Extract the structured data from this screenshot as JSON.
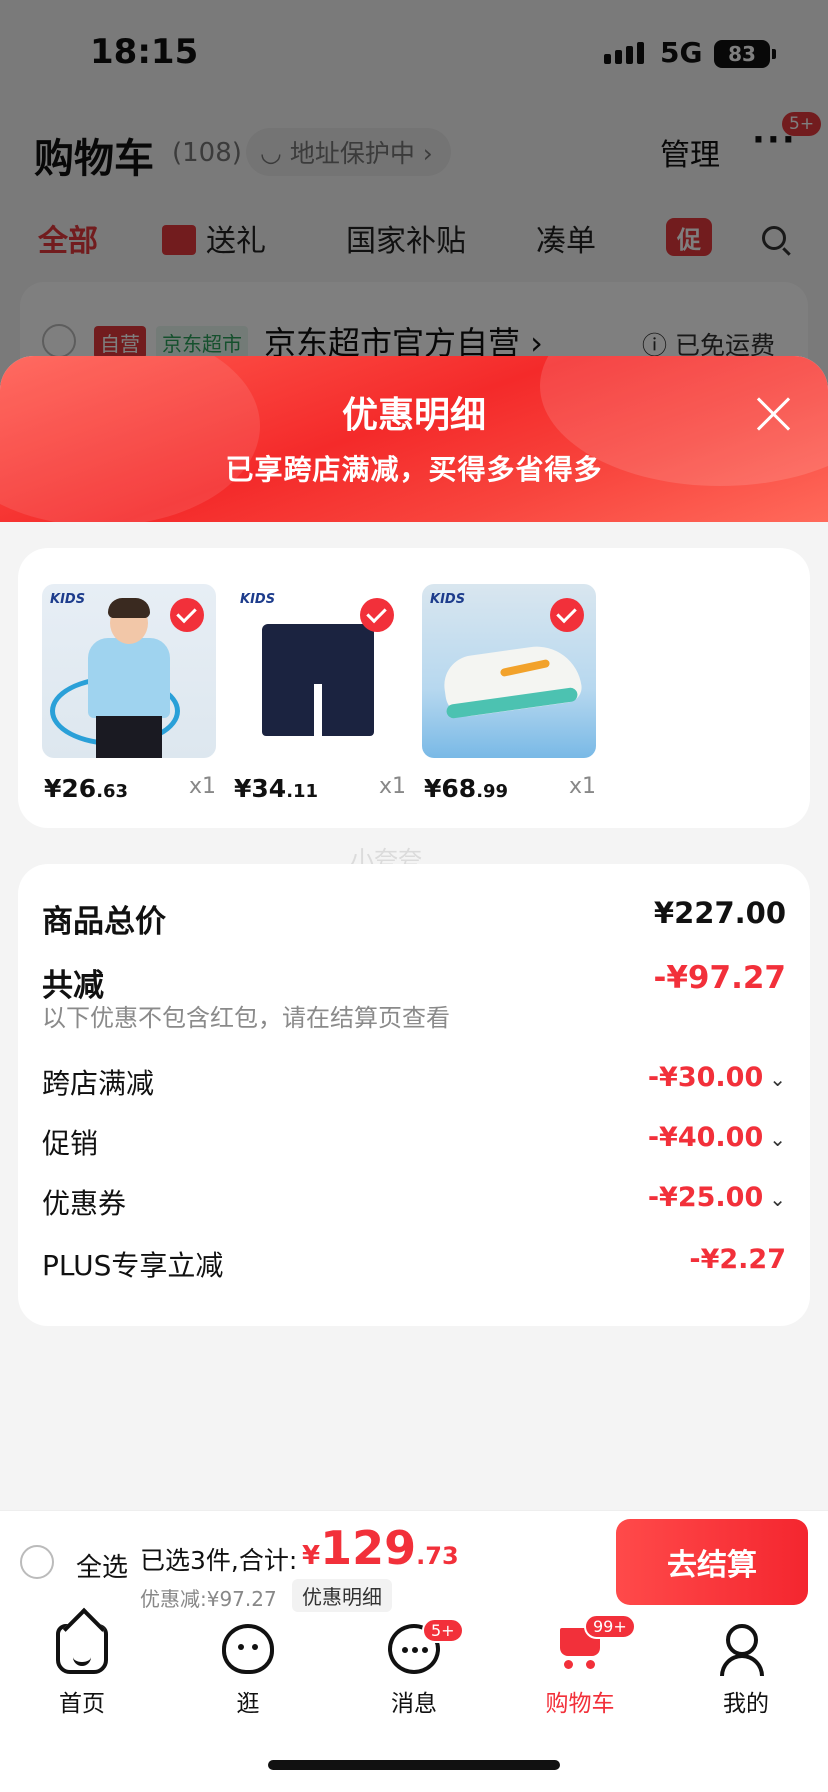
{
  "status_bar": {
    "time": "18:15",
    "network": "5G",
    "battery": "83"
  },
  "cart_header": {
    "title": "购物车",
    "count": "(108)",
    "address_protection": "地址保护中 ›",
    "manage": "管理",
    "more": "···",
    "more_badge": "5+"
  },
  "cart_tabs": {
    "all": "全部",
    "gift": "送礼",
    "national_subsidy": "国家补贴",
    "bundle": "凑单",
    "promo": "促"
  },
  "store_row": {
    "tag_self": "自营",
    "tag_market": "京东超市",
    "store_name": "京东超市官方自营 ›",
    "free_shipping": "ⓘ 已免运费"
  },
  "sheet": {
    "title": "优惠明细",
    "subtitle": "已享跨店满减，买得多省得多",
    "watermark": "小夸夸"
  },
  "products": [
    {
      "brand": "KIDS",
      "price_int": "¥26",
      "price_dec": ".63",
      "qty": "x1",
      "checked": true
    },
    {
      "brand": "KIDS",
      "price_int": "¥34",
      "price_dec": ".11",
      "qty": "x1",
      "checked": true
    },
    {
      "brand": "KIDS",
      "price_int": "¥68",
      "price_dec": ".99",
      "qty": "x1",
      "checked": true
    }
  ],
  "details": {
    "total_label": "商品总价",
    "total_value": "¥227.00",
    "reduce_label": "共减",
    "reduce_value": "-¥97.27",
    "reduce_note": "以下优惠不包含红包，请在结算页查看",
    "items": [
      {
        "label": "跨店满减",
        "value": "-¥30.00",
        "chevron": "⌄"
      },
      {
        "label": "促销",
        "value": "-¥40.00",
        "chevron": "⌄"
      },
      {
        "label": "优惠券",
        "value": "-¥25.00",
        "chevron": "⌄"
      },
      {
        "label": "PLUS专享立减",
        "value": "-¥2.27"
      }
    ]
  },
  "checkout": {
    "select_all": "全选",
    "selected_info": "已选3件,合计:",
    "currency": "¥",
    "total_int": "129",
    "total_dec": ".73",
    "discount": "优惠减:¥97.27",
    "discount_detail": "优惠明细",
    "button": "去结算"
  },
  "tabbar": [
    {
      "label": "首页",
      "icon": "home-icon"
    },
    {
      "label": "逛",
      "icon": "stroll-icon"
    },
    {
      "label": "消息",
      "icon": "message-icon",
      "badge": "5+"
    },
    {
      "label": "购物车",
      "icon": "cart-icon",
      "badge": "99+",
      "active": true
    },
    {
      "label": "我的",
      "icon": "profile-icon"
    }
  ],
  "colors": {
    "accent": "#f2303a",
    "header_gradient_start": "#ff5a4f",
    "header_gradient_end": "#f42a2a"
  }
}
